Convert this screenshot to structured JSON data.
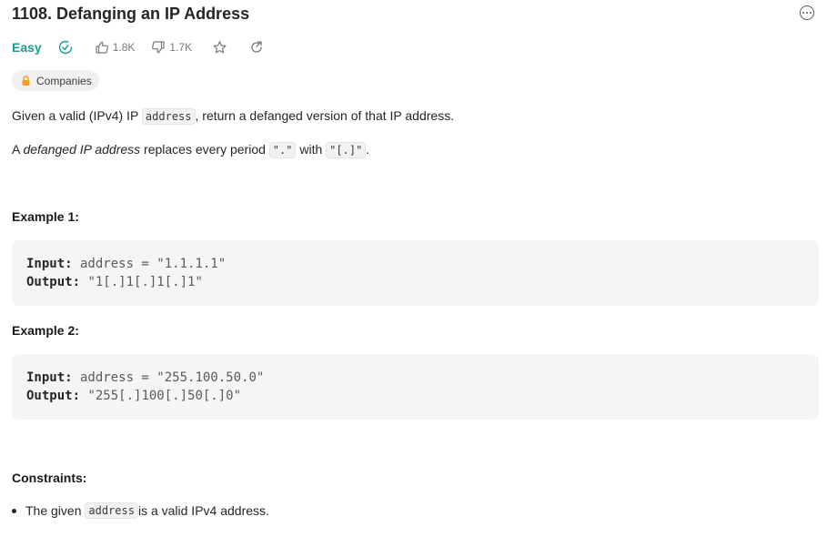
{
  "problem": {
    "title": "1108. Defanging an IP Address",
    "difficulty": "Easy",
    "likes": "1.8K",
    "dislikes": "1.7K",
    "companies_label": "Companies"
  },
  "description": {
    "p1_before": "Given a valid (IPv4) IP ",
    "p1_code": "address",
    "p1_after": ", return a defanged version of that IP address.",
    "p2_a": "A ",
    "p2_em": "defanged IP address",
    "p2_b": " replaces every period ",
    "p2_code1": "\".\"",
    "p2_c": " with ",
    "p2_code2": "\"[.]\"",
    "p2_d": "."
  },
  "examples": [
    {
      "heading": "Example 1:",
      "input_label": "Input:",
      "input_value": " address = \"1.1.1.1\"",
      "output_label": "Output:",
      "output_value": " \"1[.]1[.]1[.]1\""
    },
    {
      "heading": "Example 2:",
      "input_label": "Input:",
      "input_value": " address = \"255.100.50.0\"",
      "output_label": "Output:",
      "output_value": " \"255[.]100[.]50[.]0\""
    }
  ],
  "constraints": {
    "heading": "Constraints:",
    "items": [
      {
        "before": "The given ",
        "code": "address",
        "after": " is a valid IPv4 address."
      }
    ]
  },
  "icons": {
    "solved": "check-circle-icon",
    "like": "thumbs-up-icon",
    "dislike": "thumbs-down-icon",
    "star": "star-icon",
    "share": "share-icon",
    "lock": "lock-icon",
    "more": "more-icon"
  },
  "colors": {
    "easy": "#1a9e8f",
    "lock": "#f0a020"
  }
}
